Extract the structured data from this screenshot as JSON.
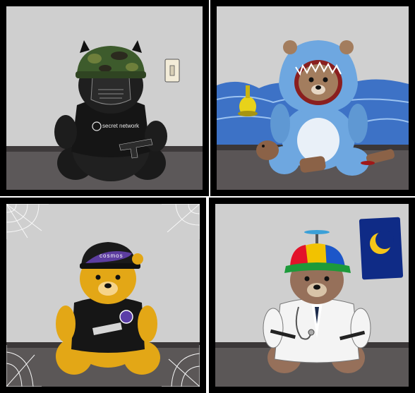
{
  "panels": [
    {
      "id": "secret-bear",
      "tshirt_text": "secret network",
      "background": "#cfcfcf",
      "floor": "#5c5859",
      "suit_color": "#1d1d1d",
      "helmet_camo": [
        "#3d5b2c",
        "#6e7f3b",
        "#2b2a1e"
      ]
    },
    {
      "id": "shark-bear",
      "background": "#d0d0d0",
      "floor": "#5a5556",
      "shark_color": "#6ea7e0",
      "fur_color": "#a37d5e",
      "wave_color": "#3d72c6"
    },
    {
      "id": "gold-bear",
      "cap_text": "cosmos",
      "background": "#cfcfcf",
      "floor": "#5b5757",
      "gold_color": "#e3a716",
      "shirt_color": "#161616"
    },
    {
      "id": "doctor-bear",
      "background": "#cfcfcf",
      "floor": "#5b5757",
      "fur_color": "#96705a",
      "coat_color": "#f4f4f4",
      "poster_color": "#0f2b86",
      "moon_color": "#f5c518",
      "cap_colors": [
        "#e3122a",
        "#f2c200",
        "#1c56c9",
        "#1d9a3a"
      ]
    }
  ]
}
